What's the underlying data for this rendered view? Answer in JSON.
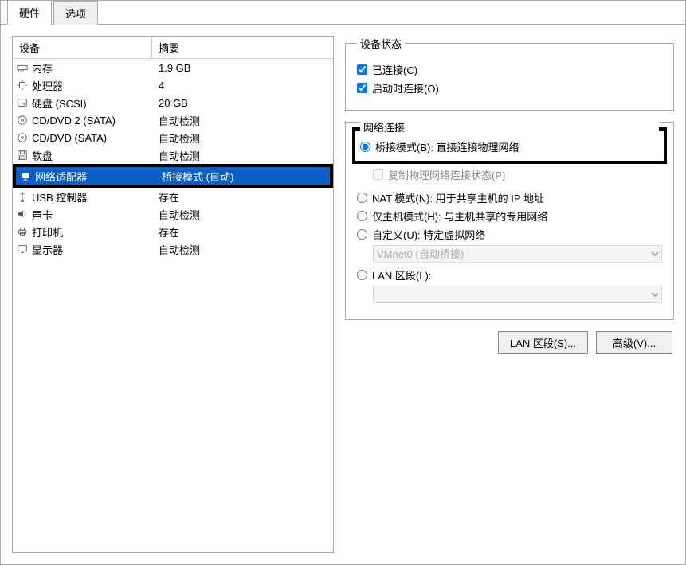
{
  "tabs": {
    "hardware": "硬件",
    "options": "选项"
  },
  "headers": {
    "device": "设备",
    "summary": "摘要"
  },
  "devices": [
    {
      "name": "内存",
      "summary": "1.9 GB",
      "icon": "memory"
    },
    {
      "name": "处理器",
      "summary": "4",
      "icon": "cpu"
    },
    {
      "name": "硬盘 (SCSI)",
      "summary": "20 GB",
      "icon": "disk"
    },
    {
      "name": "CD/DVD 2 (SATA)",
      "summary": "自动检测",
      "icon": "cd"
    },
    {
      "name": "CD/DVD (SATA)",
      "summary": "自动检测",
      "icon": "cd"
    },
    {
      "name": "软盘",
      "summary": "自动检测",
      "icon": "floppy"
    },
    {
      "name": "网络适配器",
      "summary": "桥接模式 (自动)",
      "icon": "network",
      "selected": true,
      "boxed": true
    },
    {
      "name": "USB 控制器",
      "summary": "存在",
      "icon": "usb"
    },
    {
      "name": "声卡",
      "summary": "自动检测",
      "icon": "sound"
    },
    {
      "name": "打印机",
      "summary": "存在",
      "icon": "printer"
    },
    {
      "name": "显示器",
      "summary": "自动检测",
      "icon": "display"
    }
  ],
  "status": {
    "legend": "设备状态",
    "connected": "已连接(C)",
    "connectAtPowerOn": "启动时连接(O)"
  },
  "network": {
    "legend": "网络连接",
    "bridged": "桥接模式(B): 直接连接物理网络",
    "replicate": "复制物理网络连接状态(P)",
    "nat": "NAT 模式(N): 用于共享主机的 IP 地址",
    "hostonly": "仅主机模式(H): 与主机共享的专用网络",
    "custom": "自定义(U): 特定虚拟网络",
    "customSelect": "VMnet0 (自动桥接)",
    "lanseg": "LAN 区段(L):"
  },
  "buttons": {
    "lansegments": "LAN 区段(S)...",
    "advanced": "高级(V)..."
  }
}
